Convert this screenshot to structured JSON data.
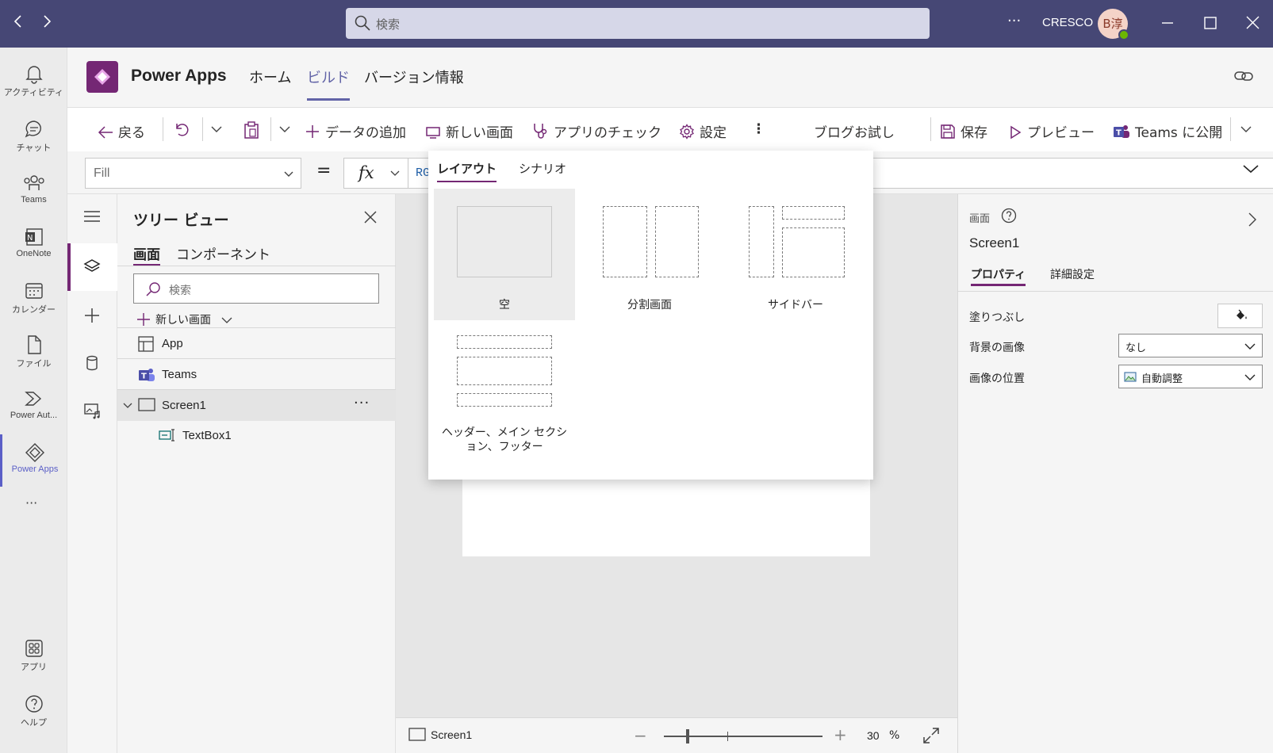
{
  "titlebar": {
    "search_placeholder": "検索",
    "more": "···",
    "org": "CRESCO",
    "avatar_initials": "B淳"
  },
  "rail": {
    "items": [
      {
        "label": "アクティビティ",
        "icon": "bell-icon"
      },
      {
        "label": "チャット",
        "icon": "chat-icon"
      },
      {
        "label": "Teams",
        "icon": "teams-icon"
      },
      {
        "label": "OneNote",
        "icon": "onenote-icon"
      },
      {
        "label": "カレンダー",
        "icon": "calendar-icon"
      },
      {
        "label": "ファイル",
        "icon": "file-icon"
      },
      {
        "label": "Power Aut...",
        "icon": "power-automate-icon"
      },
      {
        "label": "Power Apps",
        "icon": "power-apps-icon"
      }
    ],
    "more": "···",
    "bottom": [
      {
        "label": "アプリ",
        "icon": "apps-icon"
      },
      {
        "label": "ヘルプ",
        "icon": "help-icon"
      }
    ],
    "active_color": "#5b5fc7"
  },
  "app": {
    "name": "Power Apps",
    "tabs": [
      "ホーム",
      "ビルド",
      "バージョン情報"
    ],
    "active_tab": "ビルド",
    "accent": "#742774"
  },
  "toolbar": {
    "back": "戻る",
    "add_data": "データの追加",
    "new_screen": "新しい画面",
    "app_check": "アプリのチェック",
    "settings": "設定",
    "more": "⋮",
    "blog": "ブログお試し",
    "save": "保存",
    "preview": "プレビュー",
    "publish": "Teams に公開"
  },
  "formula": {
    "property": "Fill",
    "equals": "=",
    "fx": "fx",
    "value_prefix": "RGB"
  },
  "tree": {
    "title": "ツリー ビュー",
    "tabs": [
      "画面",
      "コンポーネント"
    ],
    "search_placeholder": "検索",
    "new_screen": "新しい画面",
    "items": [
      {
        "label": "App",
        "icon": "app-icon"
      },
      {
        "label": "Teams",
        "icon": "teams-icon"
      },
      {
        "label": "Screen1",
        "icon": "screen-icon"
      },
      {
        "label": "TextBox1",
        "icon": "textbox-icon"
      }
    ],
    "row_more": "···"
  },
  "flyout": {
    "tabs": [
      "レイアウト",
      "シナリオ"
    ],
    "layouts": [
      {
        "label": "空"
      },
      {
        "label": "分割画面"
      },
      {
        "label": "サイドバー"
      },
      {
        "label": "ヘッダー、メイン セクション、フッター"
      }
    ]
  },
  "statusbar": {
    "screen": "Screen1",
    "zoom": "30",
    "zoom_unit": "%",
    "zoom_minus": "−",
    "zoom_plus": "+"
  },
  "properties": {
    "kind": "画面",
    "name": "Screen1",
    "tabs": [
      "プロパティ",
      "詳細設定"
    ],
    "fill_label": "塗りつぶし",
    "bg_image_label": "背景の画像",
    "bg_image_value": "なし",
    "image_position_label": "画像の位置",
    "image_position_value": "自動調整"
  }
}
